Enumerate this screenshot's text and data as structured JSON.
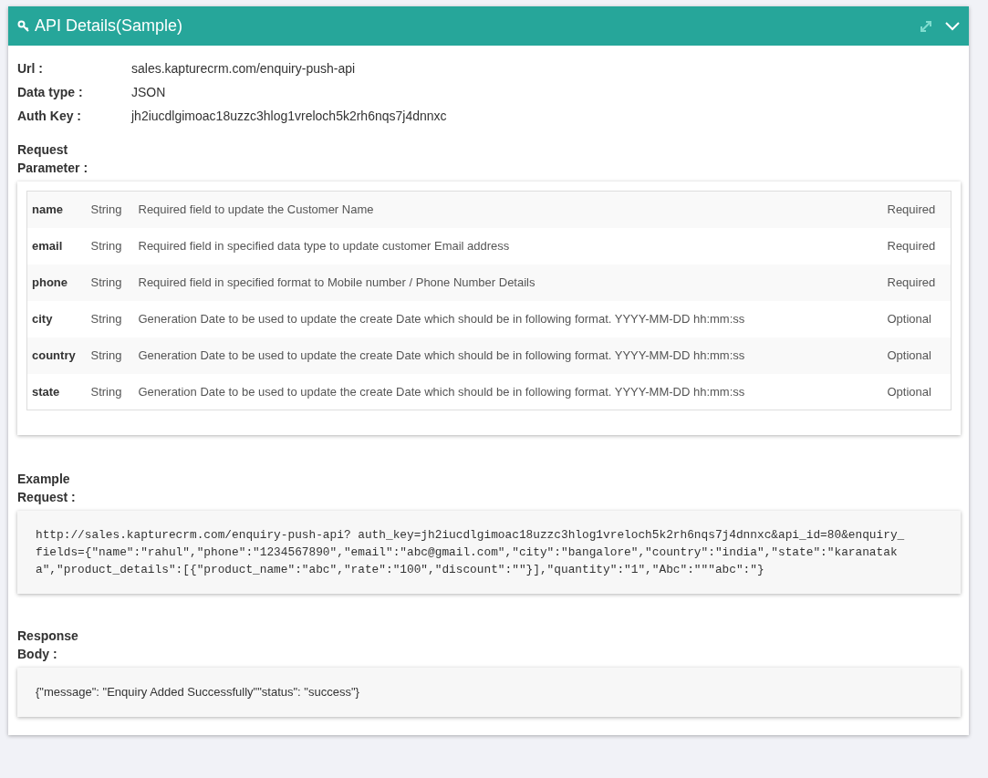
{
  "panel": {
    "title": "API Details(Sample)"
  },
  "details": [
    {
      "label": "Url :",
      "value": "sales.kapturecrm.com/enquiry-push-api"
    },
    {
      "label": "Data type :",
      "value": "JSON"
    },
    {
      "label": "Auth Key :",
      "value": "jh2iucdlgimoac18uzzc3hlog1vreloch5k2rh6nqs7j4dnnxc"
    }
  ],
  "request_parameter": {
    "heading": "Request Parameter :",
    "rows": [
      {
        "name": "name",
        "type": "String",
        "description": "Required field to update the Customer Name",
        "requirement": "Required"
      },
      {
        "name": "email",
        "type": "String",
        "description": "Required field in specified data type to update customer Email address",
        "requirement": "Required"
      },
      {
        "name": "phone",
        "type": "String",
        "description": "Required field in specified format to Mobile number / Phone Number Details",
        "requirement": "Required"
      },
      {
        "name": "city",
        "type": "String",
        "description": "Generation Date to be used to update the create Date which should be in following format. YYYY-MM-DD hh:mm:ss",
        "requirement": "Optional"
      },
      {
        "name": "country",
        "type": "String",
        "description": "Generation Date to be used to update the create Date which should be in following format. YYYY-MM-DD hh:mm:ss",
        "requirement": "Optional"
      },
      {
        "name": "state",
        "type": "String",
        "description": "Generation Date to be used to update the create Date which should be in following format. YYYY-MM-DD hh:mm:ss",
        "requirement": "Optional"
      }
    ]
  },
  "example_request": {
    "heading": "Example Request :",
    "code": "http://sales.kapturecrm.com/enquiry-push-api? auth_key=jh2iucdlgimoac18uzzc3hlog1vreloch5k2rh6nqs7j4dnnxc&api_id=80&enquiry_fields={\"name\":\"rahul\",\"phone\":\"1234567890\",\"email\":\"abc@gmail.com\",\"city\":\"bangalore\",\"country\":\"india\",\"state\":\"karanataka\",\"product_details\":[{\"product_name\":\"abc\",\"rate\":\"100\",\"discount\":\"\"}],\"quantity\":\"1\",\"Abc\":\"\"\"abc\":\"}"
  },
  "response_body": {
    "heading": "Response Body :",
    "body": "{\"message\": \"Enquiry Added Successfully\"\"status\": \"success\"}"
  }
}
